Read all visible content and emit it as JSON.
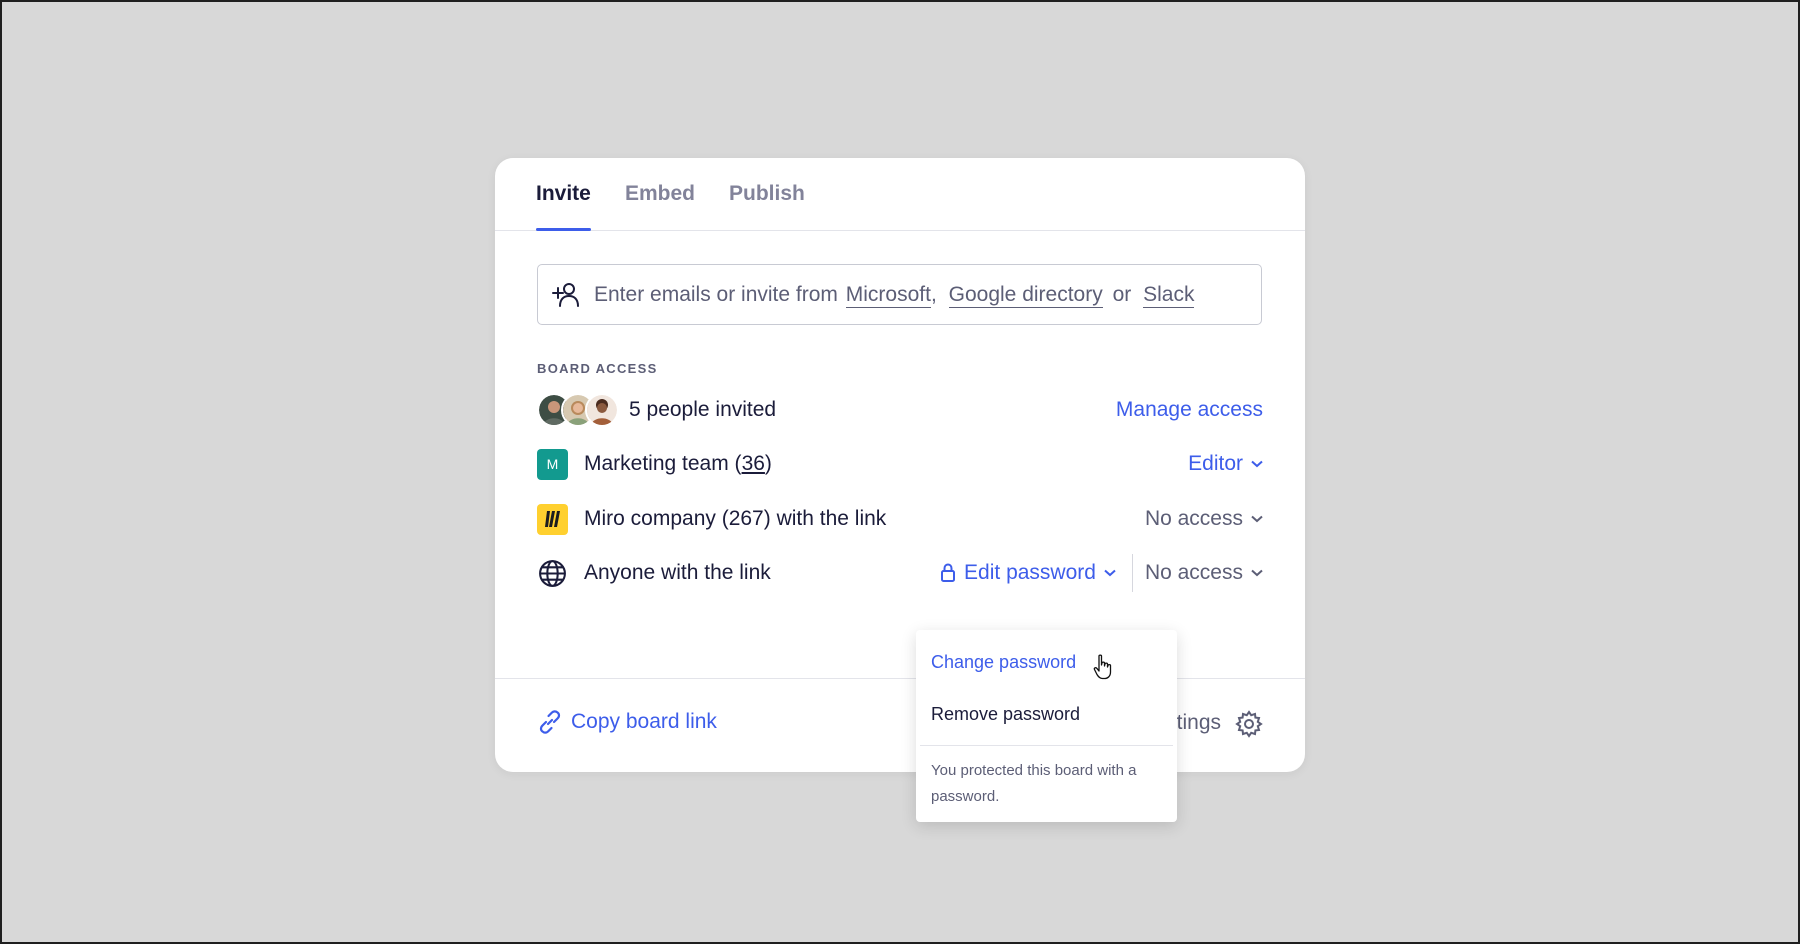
{
  "tabs": [
    {
      "label": "Invite",
      "active": true
    },
    {
      "label": "Embed",
      "active": false
    },
    {
      "label": "Publish",
      "active": false
    }
  ],
  "invite": {
    "prefix": "Enter emails or invite from",
    "link_microsoft": "Microsoft",
    "comma": ",",
    "link_google": "Google directory",
    "or": "or",
    "link_slack": "Slack",
    "icon": "add-person-icon"
  },
  "board_access": {
    "section_label": "BOARD ACCESS",
    "rows": [
      {
        "label": "5 people invited",
        "action": "Manage access",
        "icon": "avatars"
      },
      {
        "label_main": "Marketing team (",
        "label_count": "36",
        "label_end": ")",
        "badge": "M",
        "permission": "Editor"
      },
      {
        "label": "Miro company (267) with the link",
        "permission": "No access",
        "icon": "miro-logo"
      },
      {
        "label": "Anyone with the link",
        "password_action": "Edit password",
        "permission": "No access",
        "icon": "globe-icon"
      }
    ]
  },
  "footer": {
    "copy_link": "Copy board link",
    "settings_partial": "tings"
  },
  "dropdown": {
    "change_password": "Change password",
    "remove_password": "Remove password",
    "note": "You protected this board with a password."
  },
  "colors": {
    "accent": "#3d5dea",
    "text": "#1b1c3a",
    "muted": "#5c5e76",
    "team_badge": "#129a8f",
    "miro_badge": "#ffd02f"
  }
}
